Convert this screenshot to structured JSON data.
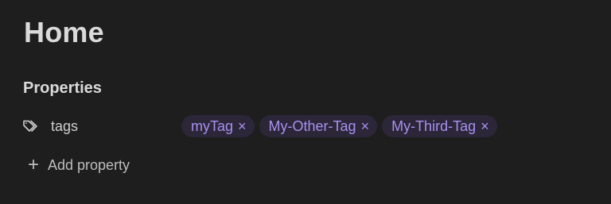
{
  "page": {
    "title": "Home"
  },
  "properties": {
    "heading": "Properties",
    "rows": [
      {
        "icon": "tags-icon",
        "key": "tags",
        "values": [
          "myTag",
          "My-Other-Tag",
          "My-Third-Tag"
        ],
        "remove_glyph": "×"
      }
    ],
    "add": {
      "icon": "plus-icon",
      "glyph": "+",
      "label": "Add property"
    }
  },
  "colors": {
    "background": "#1e1e1e",
    "text": "#dadada",
    "tag_text": "#a890f0",
    "tag_background": "#2b2638"
  }
}
